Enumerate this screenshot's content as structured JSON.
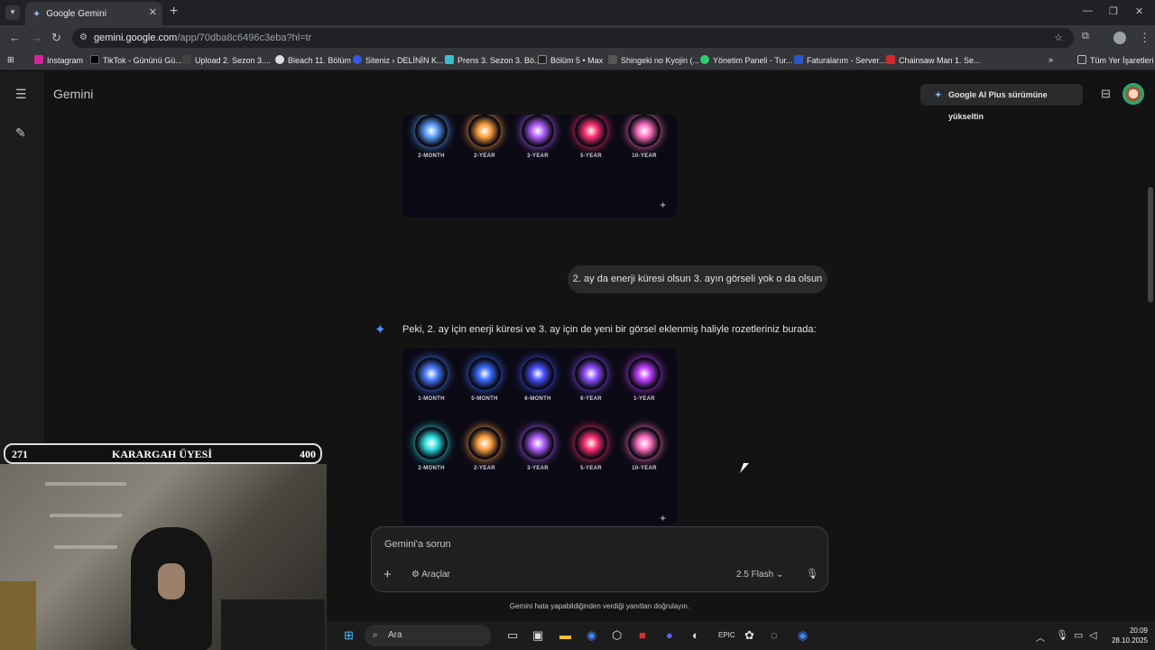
{
  "browser": {
    "tab_title": "Google Gemini",
    "url_host": "gemini.google.com",
    "url_path": "/app/70dba8c6496c3eba?hl=tr",
    "bookmarks": [
      "Instagram",
      "TikTok - Gününü Gü...",
      "Upload 2. Sezon 3....",
      "Bleach 11. Bölüm",
      "Siteniz › DELİNİN K...",
      "Prens 3. Sezon 3. Bö...",
      "Bölüm 5 • Max",
      "Shingeki no Kyojin (...",
      "Yönetim Paneli - Tur...",
      "Faturalarım - Server...",
      "Chainsaw Man 1. Se..."
    ],
    "all_bookmarks": "Tüm Yer İşaretleri"
  },
  "header": {
    "brand": "Gemini",
    "upgrade_label": "Google AI Plus sürümüne yükseltin"
  },
  "card1": {
    "badges": [
      {
        "label": "2-MONTH",
        "color": "#5aa0ff"
      },
      {
        "label": "2-YEAR",
        "color": "#ffa040"
      },
      {
        "label": "3-YEAR",
        "color": "#b060ff"
      },
      {
        "label": "5-YEAR",
        "color": "#ff3070"
      },
      {
        "label": "10-YEAR",
        "color": "#ff70c0"
      }
    ]
  },
  "chat": {
    "user_message": "2. ay da enerji küresi olsun 3. ayın görseli yok o da olsun",
    "model_response": "Peki, 2. ay için enerji küresi ve 3. ay için de yeni bir görsel eklenmiş haliyle rozetleriniz burada:"
  },
  "card2": {
    "row1": [
      {
        "label": "1-MONTH",
        "color": "#4a7dff"
      },
      {
        "label": "5-MONTH",
        "color": "#3a6cff"
      },
      {
        "label": "6-MONTH",
        "color": "#4a50ff"
      },
      {
        "label": "6-YEAR",
        "color": "#9050ff"
      },
      {
        "label": "1-YEAR",
        "color": "#c040ff"
      }
    ],
    "row2": [
      {
        "label": "2-MONTH",
        "color": "#30e0e0"
      },
      {
        "label": "2-YEAR",
        "color": "#ffa040"
      },
      {
        "label": "3-YEAR",
        "color": "#b060ff"
      },
      {
        "label": "5-YEAR",
        "color": "#ff3070"
      },
      {
        "label": "10-YEAR",
        "color": "#ff70c0"
      }
    ]
  },
  "composer": {
    "placeholder": "Gemini'a sorun",
    "tools_label": "Araçlar",
    "model_label": "2.5 Flash"
  },
  "disclaimer": "Gemini hata yapabildiğinden verdiği yanıtları doğrulayın.",
  "overlay": {
    "left_num": "271",
    "title": "KARARGAH ÜYESİ",
    "right_num": "400"
  },
  "taskbar": {
    "search_placeholder": "Ara",
    "time": "20:09",
    "date": "28.10.2025"
  }
}
